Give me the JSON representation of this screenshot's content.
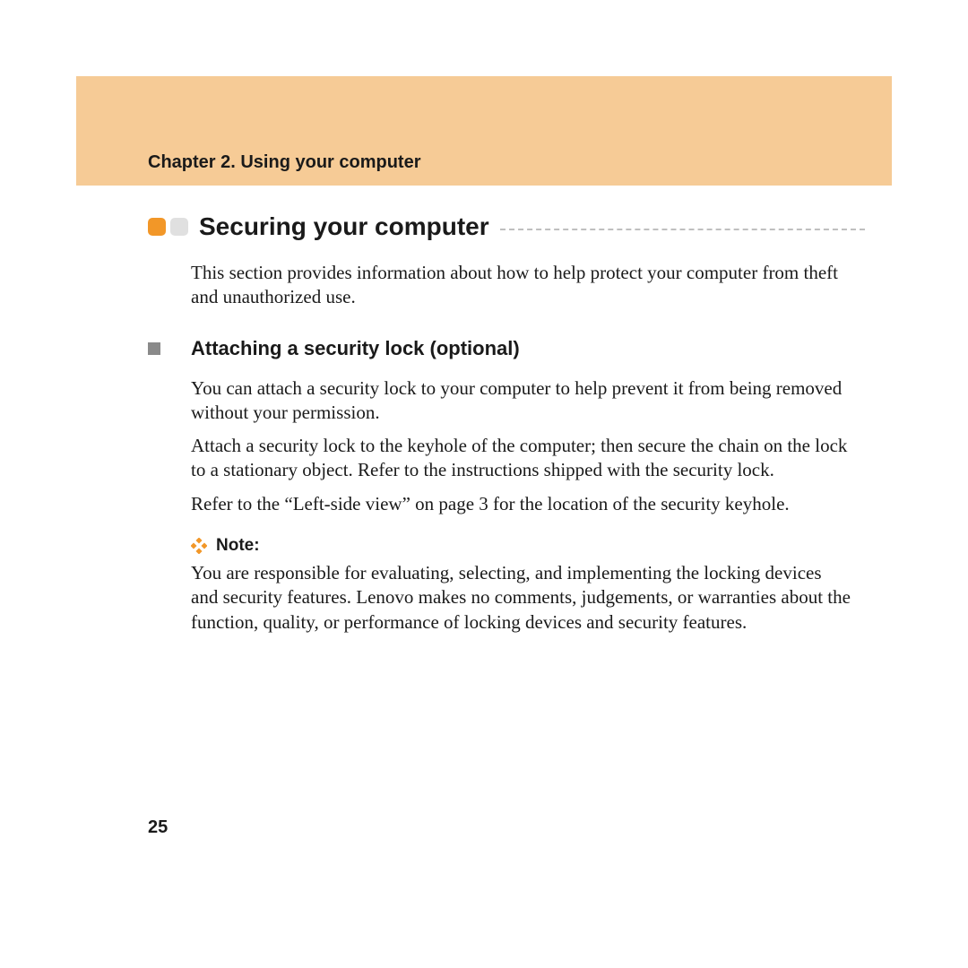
{
  "header": {
    "chapter_title": "Chapter 2. Using your computer"
  },
  "section": {
    "title": "Securing your computer",
    "intro": "This section provides information about how to help protect your computer from theft and unauthorized use."
  },
  "subsection": {
    "title": "Attaching a security lock (optional)",
    "para1": "You can attach a security lock to your computer to help prevent it from being removed without your permission.",
    "para2": "Attach a security lock to the keyhole of the computer; then secure the chain on the lock to a stationary object. Refer to the instructions shipped with the security lock.",
    "para3": "Refer to the “Left-side view” on page 3 for the location of the security keyhole."
  },
  "note": {
    "label": "Note:",
    "text": "You are responsible for evaluating, selecting, and implementing the locking devices and security features. Lenovo makes no comments, judgements, or warranties about the function, quality, or performance of locking devices and security features."
  },
  "page_number": "25"
}
